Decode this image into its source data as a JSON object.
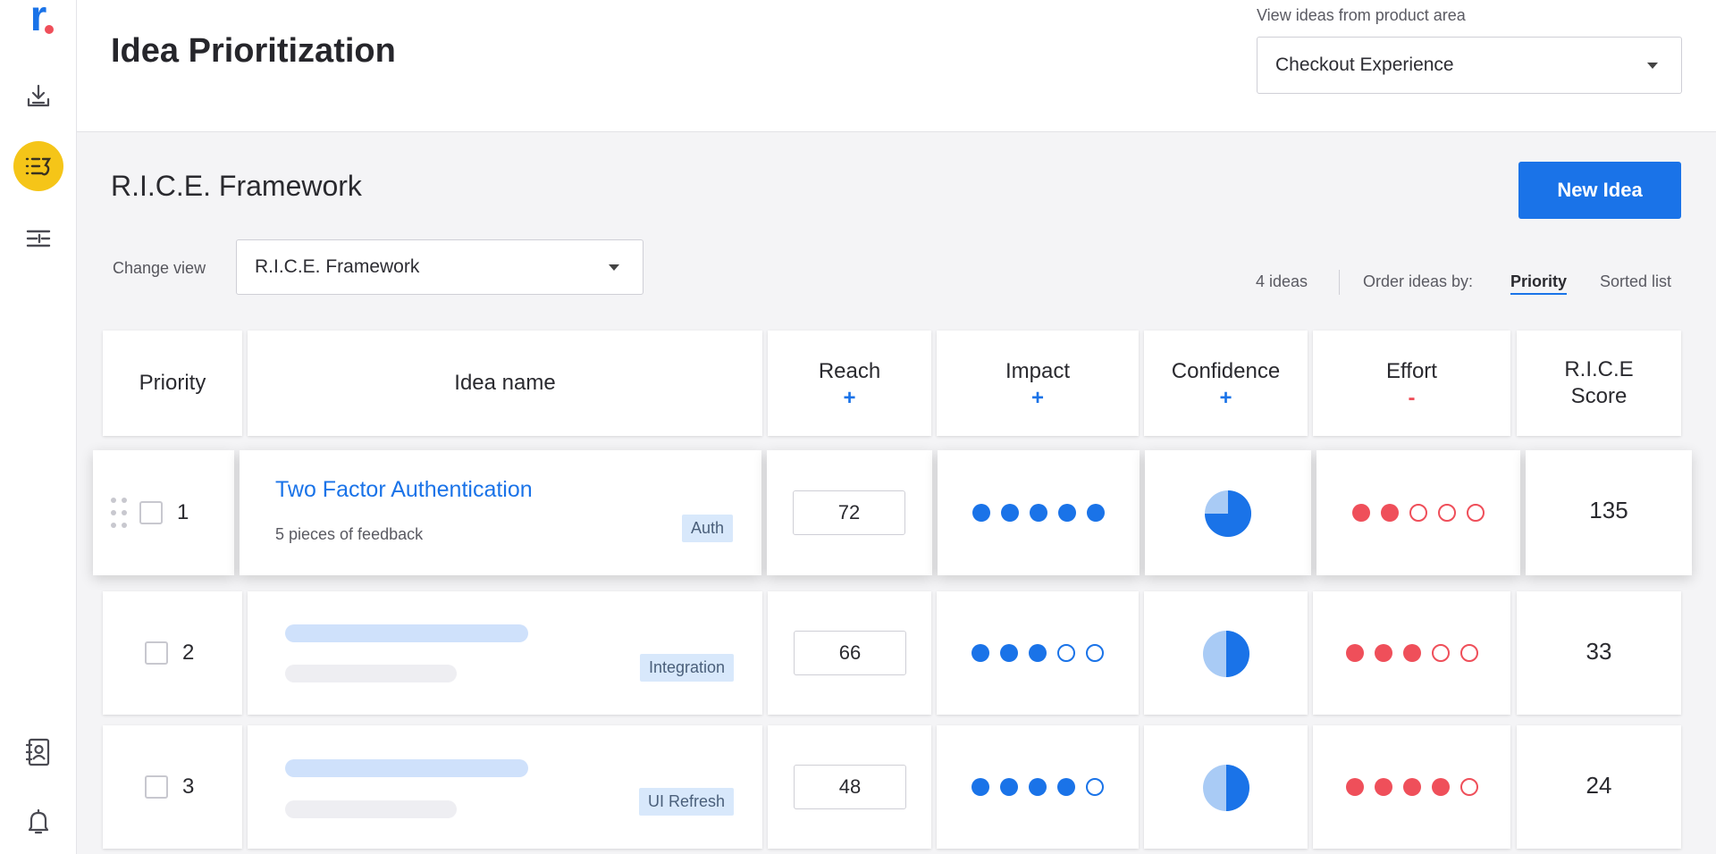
{
  "header": {
    "title": "Idea Prioritization",
    "area_label": "View ideas from product area",
    "area_value": "Checkout Experience"
  },
  "section": {
    "title": "R.I.C.E. Framework",
    "new_button": "New Idea",
    "change_view_label": "Change view",
    "view_value": "R.I.C.E. Framework",
    "ideas_count": "4 ideas",
    "order_label": "Order ideas by:",
    "order_priority": "Priority",
    "order_sorted": "Sorted list"
  },
  "table": {
    "headers": {
      "priority": "Priority",
      "idea_name": "Idea name",
      "reach": "Reach",
      "reach_sign": "+",
      "impact": "Impact",
      "impact_sign": "+",
      "confidence": "Confidence",
      "confidence_sign": "+",
      "effort": "Effort",
      "effort_sign": "-",
      "score_line1": "R.I.C.E",
      "score_line2": "Score"
    },
    "rows": [
      {
        "rank": "1",
        "title": "Two Factor Authentication",
        "feedback": "5 pieces of feedback",
        "tag": "Auth",
        "reach": "72",
        "impact": 5,
        "confidence": 0.75,
        "effort": 2,
        "score": "135"
      },
      {
        "rank": "2",
        "title": "",
        "feedback": "",
        "tag": "Integration",
        "reach": "66",
        "impact": 3,
        "confidence": 0.5,
        "effort": 3,
        "score": "33"
      },
      {
        "rank": "3",
        "title": "",
        "feedback": "",
        "tag": "UI Refresh",
        "reach": "48",
        "impact": 4,
        "confidence": 0.5,
        "effort": 4,
        "score": "24"
      }
    ],
    "scale_max": 5
  },
  "colors": {
    "accent": "#1a73e8",
    "effort": "#ef4f5a",
    "active_nav": "#f5c518",
    "pie_light": "#a9cbf5"
  },
  "sidebar": {
    "icons": [
      "logo-icon",
      "download-icon",
      "priority-list-icon",
      "sliders-icon",
      "contacts-icon",
      "bell-icon"
    ]
  }
}
